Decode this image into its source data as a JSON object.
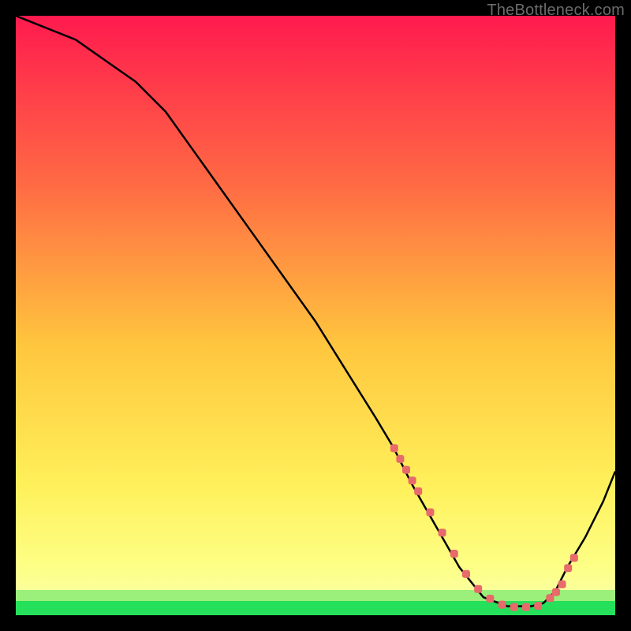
{
  "watermark": "TheBottleneck.com",
  "chart_data": {
    "type": "line",
    "title": "",
    "xlabel": "",
    "ylabel": "",
    "xlim": [
      0,
      100
    ],
    "ylim": [
      0,
      100
    ],
    "gradient_colors": {
      "top": "#ff1a4e",
      "mid1": "#ff7a3f",
      "mid2": "#ffd23b",
      "mid3": "#fff861",
      "bottom_band": "#24e05b"
    },
    "series": [
      {
        "name": "curve",
        "x": [
          0,
          10,
          20,
          25,
          30,
          35,
          40,
          45,
          50,
          55,
          60,
          63,
          66,
          70,
          74,
          78,
          82,
          86,
          88,
          90,
          92,
          95,
          98,
          100
        ],
        "y": [
          100,
          96,
          89,
          84,
          77,
          70,
          63,
          56,
          49,
          41,
          33,
          28,
          22,
          15,
          8,
          3,
          1.5,
          1.5,
          2,
          4,
          8,
          13,
          19,
          24
        ]
      }
    ],
    "annotations": [
      {
        "name": "dotted-segment",
        "style": "red-dots",
        "x": [
          63,
          64,
          65,
          66,
          67,
          69,
          71,
          73,
          75,
          77,
          79,
          81,
          83,
          85,
          87,
          89,
          90,
          91,
          92,
          93
        ],
        "y": [
          28,
          26.2,
          24.4,
          22.6,
          20.8,
          17.3,
          13.9,
          10.4,
          7.0,
          4.5,
          2.9,
          1.9,
          1.5,
          1.5,
          1.7,
          3.0,
          4.0,
          5.3,
          8.0,
          9.7
        ]
      }
    ]
  }
}
